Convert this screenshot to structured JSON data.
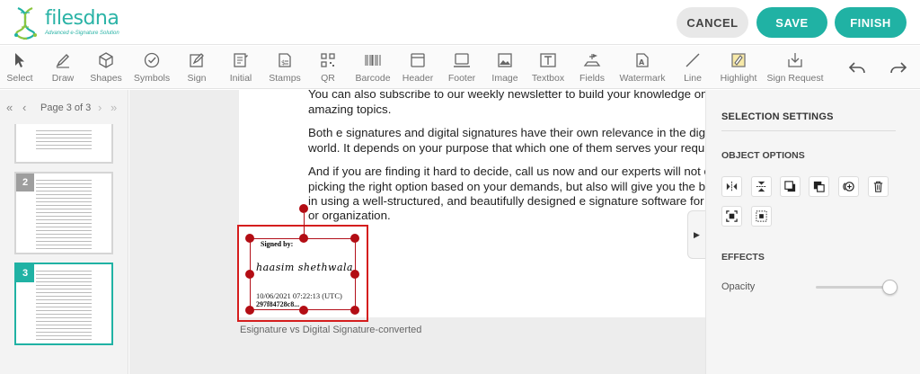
{
  "app": {
    "logo_name": "filesdna",
    "logo_tagline": "Advanced e-Signature Solution",
    "brand_color": "#20b2a4"
  },
  "actions": {
    "cancel": "CANCEL",
    "save": "SAVE",
    "finish": "FINISH"
  },
  "toolbar": {
    "tools": [
      {
        "label": "Select",
        "icon": "cursor-icon"
      },
      {
        "label": "Draw",
        "icon": "pen-icon"
      },
      {
        "label": "Shapes",
        "icon": "cube-icon"
      },
      {
        "label": "Symbols",
        "icon": "check-circle-icon"
      },
      {
        "label": "Sign",
        "icon": "sign-icon"
      },
      {
        "label": "Initial",
        "icon": "initial-icon"
      },
      {
        "label": "Stamps",
        "icon": "stamp-icon"
      },
      {
        "label": "QR",
        "icon": "qr-icon"
      },
      {
        "label": "Barcode",
        "icon": "barcode-icon"
      },
      {
        "label": "Header",
        "icon": "header-icon"
      },
      {
        "label": "Footer",
        "icon": "footer-icon"
      },
      {
        "label": "Image",
        "icon": "image-icon"
      },
      {
        "label": "Textbox",
        "icon": "textbox-icon"
      },
      {
        "label": "Fields",
        "icon": "fields-icon"
      },
      {
        "label": "Watermark",
        "icon": "watermark-icon"
      },
      {
        "label": "Line",
        "icon": "line-icon"
      },
      {
        "label": "Highlight",
        "icon": "highlight-icon"
      },
      {
        "label": "Sign Request",
        "icon": "sign-request-icon"
      }
    ],
    "undo_icon": "undo-icon",
    "redo_icon": "redo-icon"
  },
  "pager": {
    "label": "Page 3 of 3"
  },
  "thumbnails": [
    {
      "number": ""
    },
    {
      "number": "2"
    },
    {
      "number": "3"
    }
  ],
  "document": {
    "lines": [
      "You can also subscribe to our weekly newsletter to build your knowledge on more su",
      "amazing topics.",
      "Both e signatures and digital signatures have their own relevance in the digitally grow",
      "world. It depends on your purpose that which one of them serves your requirements",
      "And if you are finding it hard to decide, call us now and our experts will not only help",
      "picking the right option based on your demands, but also will give you the best exper",
      "in using a well-structured, and beautifully designed e signature software for your bus",
      "or organization."
    ],
    "caption": "Esignature vs Digital Signature-converted"
  },
  "signature": {
    "label": "Signed by:",
    "name": "haasim shethwala",
    "timestamp": "10/06/2021 07:22:13 (UTC)",
    "hash": "297f84728c8..."
  },
  "settings": {
    "title": "SELECTION SETTINGS",
    "object_options": "OBJECT OPTIONS",
    "effects": "EFFECTS",
    "opacity_label": "Opacity",
    "opacity_value": 1.0
  }
}
